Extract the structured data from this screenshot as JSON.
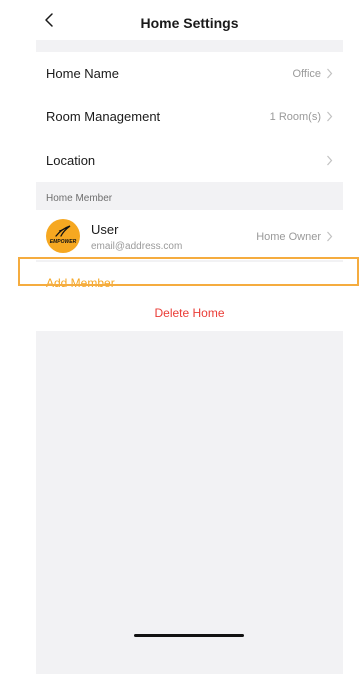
{
  "header": {
    "title": "Home Settings",
    "back_icon": "chevron-left-icon"
  },
  "settings": {
    "home_name": {
      "label": "Home Name",
      "value": "Office"
    },
    "room_management": {
      "label": "Room Management",
      "value": "1 Room(s)"
    },
    "location": {
      "label": "Location",
      "value": ""
    }
  },
  "members": {
    "section_title": "Home Member",
    "list": [
      {
        "avatar_text": "EMPOWER",
        "name": "User",
        "email": "email@address.com",
        "role": "Home Owner"
      }
    ],
    "add_label": "Add Member"
  },
  "actions": {
    "delete_label": "Delete Home"
  },
  "colors": {
    "accent": "#f5a623",
    "danger": "#ea3c36",
    "avatar_bg": "#f6a821",
    "highlight": "#f5ac3f"
  }
}
